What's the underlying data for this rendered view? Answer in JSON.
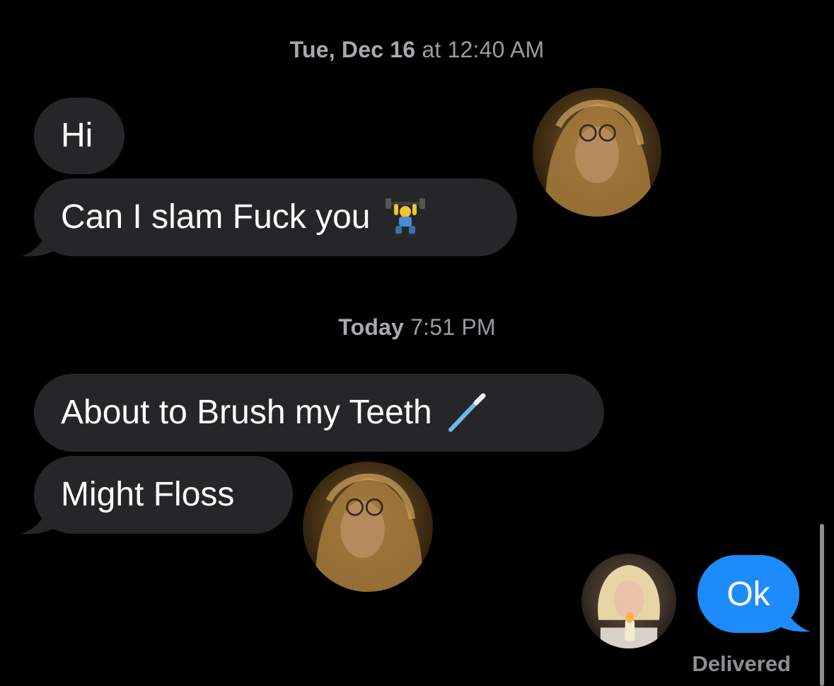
{
  "conversation": {
    "timestamps": [
      {
        "day": "Tue, Dec 16",
        "time": " at 12:40 AM"
      },
      {
        "day": "Today",
        "time": " 7:51 PM"
      }
    ],
    "incoming": [
      {
        "text": "Hi"
      },
      {
        "text": "Can I slam Fuck you",
        "emoji": "person-lifting-weights-emoji"
      },
      {
        "text": "About to Brush my Teeth",
        "emoji": "toothbrush-emoji"
      },
      {
        "text": "Might Floss"
      }
    ],
    "outgoing": [
      {
        "text": "Ok",
        "status": "Delivered"
      }
    ]
  },
  "colors": {
    "background": "#000000",
    "incoming_bubble": "#262628",
    "outgoing_bubble": "#1e8bfa",
    "timestamp_text": "#9a9aa0",
    "status_text": "#8e8e93"
  }
}
